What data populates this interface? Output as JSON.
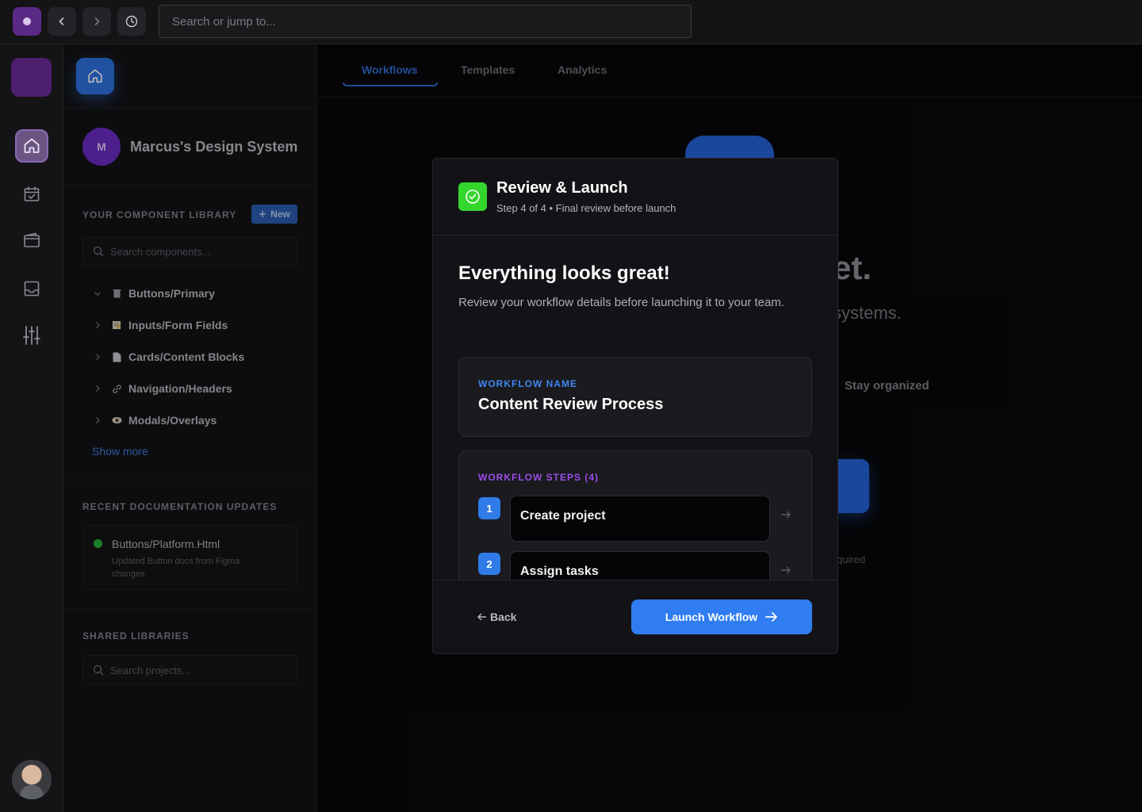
{
  "topbar": {
    "search_placeholder": "Search or jump to..."
  },
  "sidebar": {
    "workspace": {
      "initial": "M",
      "name": "Marcus's Design System"
    },
    "library": {
      "heading": "YOUR COMPONENT LIBRARY",
      "new_label": "New",
      "search_placeholder": "Search components...",
      "items": [
        {
          "label": "Buttons/Primary",
          "icon": "trash-icon",
          "expanded": true
        },
        {
          "label": "Inputs/Form Fields",
          "icon": "memo-icon",
          "expanded": false
        },
        {
          "label": "Cards/Content Blocks",
          "icon": "document-icon",
          "expanded": false
        },
        {
          "label": "Navigation/Headers",
          "icon": "link-icon",
          "expanded": false
        },
        {
          "label": "Modals/Overlays",
          "icon": "eye-icon",
          "expanded": false
        }
      ],
      "show_more": "Show more"
    },
    "docs": {
      "heading": "RECENT DOCUMENTATION UPDATES",
      "item": {
        "title": "Buttons/Platform.Html",
        "description": "Updated Button docs from Figma changes",
        "status_color": "#28b03a"
      }
    },
    "shared": {
      "heading": "SHARED LIBRARIES",
      "search_placeholder": "Search projects..."
    }
  },
  "main": {
    "tabs": [
      {
        "label": "Workflows",
        "active": true
      },
      {
        "label": "Templates",
        "active": false
      },
      {
        "label": "Analytics",
        "active": false
      }
    ],
    "background": {
      "headline_fragment": "et.",
      "sub_fragment": "systems.",
      "feature": "Stay organized",
      "note_fragment": "quired"
    }
  },
  "modal": {
    "title": "Review & Launch",
    "subtitle": "Step 4 of 4 • Final review before launch",
    "heading": "Everything looks great!",
    "description": "Review your workflow details before launching it to your team.",
    "workflow_name_label": "WORKFLOW NAME",
    "workflow_name": "Content Review Process",
    "steps_label": "WORKFLOW STEPS (4)",
    "steps": [
      {
        "number": "1",
        "label": "Create project"
      },
      {
        "number": "2",
        "label": "Assign tasks"
      }
    ],
    "back_label": "Back",
    "launch_label": "Launch Workflow"
  },
  "colors": {
    "accent_blue": "#2f7df0",
    "success_green": "#34d62e",
    "purple_label": "#9b4de8",
    "blue_label": "#3f86f0"
  }
}
